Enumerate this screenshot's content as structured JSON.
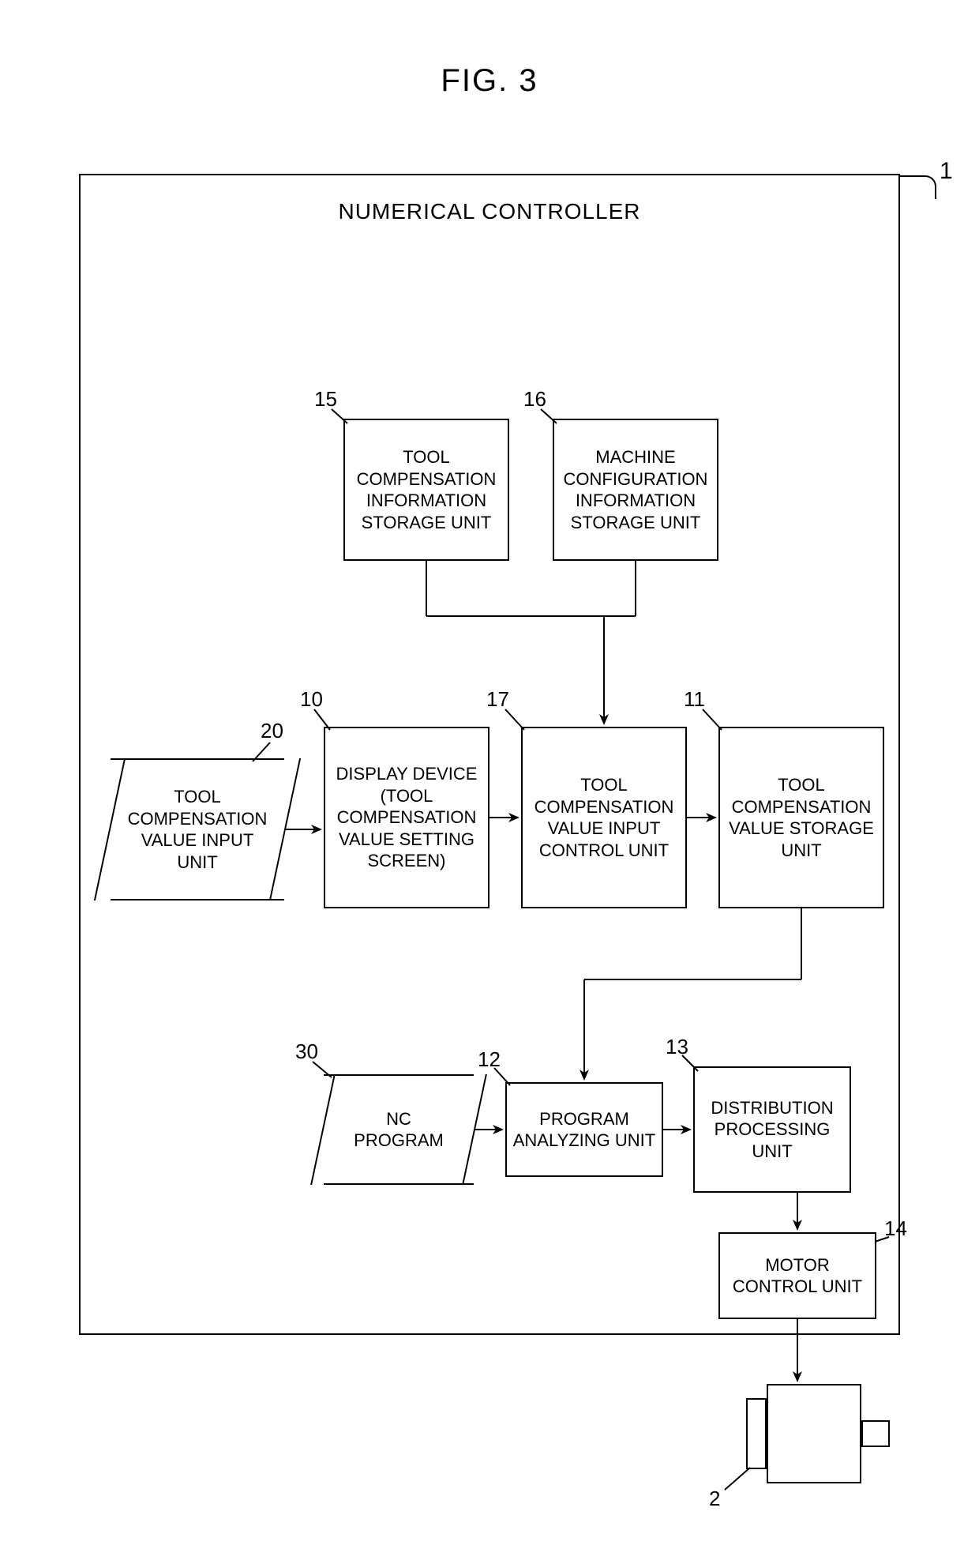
{
  "figure": {
    "title": "FIG. 3"
  },
  "controller_label": "NUMERICAL CONTROLLER",
  "refs": {
    "outer": "1",
    "motor": "2",
    "b20": "20",
    "b10": "10",
    "b15": "15",
    "b16": "16",
    "b17": "17",
    "b11": "11",
    "b30": "30",
    "b12": "12",
    "b13": "13",
    "b14": "14"
  },
  "blocks": {
    "b20": "TOOL\nCOMPENSATION\nVALUE INPUT\nUNIT",
    "b10": "DISPLAY DEVICE\n(TOOL\nCOMPENSATION\nVALUE SETTING\nSCREEN)",
    "b15": "TOOL\nCOMPENSATION\nINFORMATION\nSTORAGE UNIT",
    "b16": "MACHINE\nCONFIGURATION\nINFORMATION\nSTORAGE UNIT",
    "b17": "TOOL\nCOMPENSATION\nVALUE INPUT\nCONTROL UNIT",
    "b11": "TOOL\nCOMPENSATION\nVALUE STORAGE\nUNIT",
    "b30": "NC\nPROGRAM",
    "b12": "PROGRAM\nANALYZING UNIT",
    "b13": "DISTRIBUTION\nPROCESSING\nUNIT",
    "b14": "MOTOR\nCONTROL UNIT"
  },
  "chart_data": {
    "type": "diagram",
    "title": "FIG. 3",
    "container": {
      "id": 1,
      "label": "NUMERICAL CONTROLLER"
    },
    "nodes": [
      {
        "id": 20,
        "label": "TOOL COMPENSATION VALUE INPUT UNIT",
        "shape": "parallelogram"
      },
      {
        "id": 10,
        "label": "DISPLAY DEVICE (TOOL COMPENSATION VALUE SETTING SCREEN)",
        "shape": "rect"
      },
      {
        "id": 15,
        "label": "TOOL COMPENSATION INFORMATION STORAGE UNIT",
        "shape": "rect"
      },
      {
        "id": 16,
        "label": "MACHINE CONFIGURATION INFORMATION STORAGE UNIT",
        "shape": "rect"
      },
      {
        "id": 17,
        "label": "TOOL COMPENSATION VALUE INPUT CONTROL UNIT",
        "shape": "rect"
      },
      {
        "id": 11,
        "label": "TOOL COMPENSATION VALUE STORAGE UNIT",
        "shape": "rect"
      },
      {
        "id": 30,
        "label": "NC PROGRAM",
        "shape": "parallelogram"
      },
      {
        "id": 12,
        "label": "PROGRAM ANALYZING UNIT",
        "shape": "rect"
      },
      {
        "id": 13,
        "label": "DISTRIBUTION PROCESSING UNIT",
        "shape": "rect"
      },
      {
        "id": 14,
        "label": "MOTOR CONTROL UNIT",
        "shape": "rect"
      },
      {
        "id": 2,
        "label": "MOTOR",
        "shape": "motor"
      }
    ],
    "edges": [
      {
        "from": 20,
        "to": 10
      },
      {
        "from": 10,
        "to": 17
      },
      {
        "from": 15,
        "to": 17
      },
      {
        "from": 16,
        "to": 17
      },
      {
        "from": 17,
        "to": 11
      },
      {
        "from": 30,
        "to": 12
      },
      {
        "from": 11,
        "to": 12
      },
      {
        "from": 12,
        "to": 13
      },
      {
        "from": 13,
        "to": 14
      },
      {
        "from": 14,
        "to": 2
      }
    ]
  }
}
